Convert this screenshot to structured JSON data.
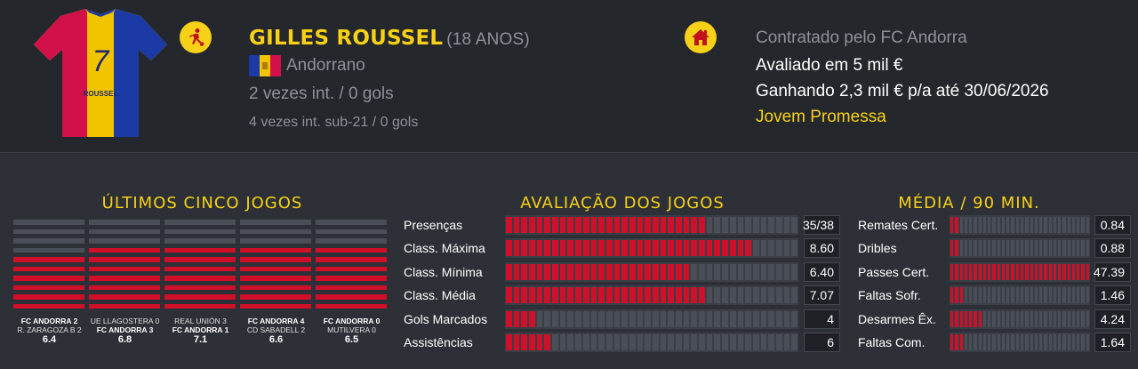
{
  "player": {
    "shirt_name": "ROUSSEL",
    "shirt_number": "7",
    "name": "GILLES ROUSSEL",
    "age": "(18 ANOS)",
    "nationality": "Andorrano",
    "caps": "2 vezes int. / 0 gols",
    "caps_u21": "4 vezes int. sub-21 / 0 gols"
  },
  "icons": {
    "position": "football-player-icon",
    "home": "home-icon"
  },
  "contract": {
    "line1": "Contratado pelo FC Andorra",
    "line2": "Avaliado em 5 mil €",
    "line3": "Ganhando 2,3 mil € p/a até 30/06/2026",
    "line4": "Jovem Promessa"
  },
  "colors": {
    "accent": "#f7d117",
    "bar_red": "#d0102a",
    "bar_grey": "#4a4e56"
  },
  "last_five": {
    "title": "ÚLTIMOS CINCO JOGOS",
    "games": [
      {
        "home": "FC ANDORRA 2",
        "away": "R. ZARAGOZA B 2",
        "home_bold": true,
        "rating": "6.4",
        "rating_value": 6.4
      },
      {
        "home": "UE LLAGOSTERA 0",
        "away": "FC ANDORRA 3",
        "home_bold": false,
        "rating": "6.8",
        "rating_value": 6.8
      },
      {
        "home": "REAL UNIÓN 3",
        "away": "FC ANDORRA 1",
        "home_bold": false,
        "rating": "7.1",
        "rating_value": 7.1
      },
      {
        "home": "FC ANDORRA 4",
        "away": "CD SABADELL 2",
        "home_bold": true,
        "rating": "6.6",
        "rating_value": 6.6
      },
      {
        "home": "FC ANDORRA 0",
        "away": "MUTILVERA 0",
        "home_bold": true,
        "rating": "6.5",
        "rating_value": 6.5
      }
    ]
  },
  "ratings": {
    "title": "AVALIAÇÃO DOS JOGOS",
    "rows": [
      {
        "label": "Presenças",
        "value": "35/38",
        "fraction": 0.66
      },
      {
        "label": "Class. Máxima",
        "value": "8.60",
        "fraction": 0.83
      },
      {
        "label": "Class. Mínima",
        "value": "6.40",
        "fraction": 0.61
      },
      {
        "label": "Class. Média",
        "value": "7.07",
        "fraction": 0.68
      },
      {
        "label": "Gols Marcados",
        "value": "4",
        "fraction": 0.1
      },
      {
        "label": "Assistências",
        "value": "6",
        "fraction": 0.15
      }
    ]
  },
  "per90": {
    "title": "MÉDIA / 90 MIN.",
    "rows": [
      {
        "label": "Remates Cert.",
        "value": "0.84",
        "fraction": 0.04
      },
      {
        "label": "Dribles",
        "value": "0.88",
        "fraction": 0.04
      },
      {
        "label": "Passes Cert.",
        "value": "47.39",
        "fraction": 0.98
      },
      {
        "label": "Faltas Sofr.",
        "value": "1.46",
        "fraction": 0.09
      },
      {
        "label": "Desarmes Êx.",
        "value": "4.24",
        "fraction": 0.22
      },
      {
        "label": "Faltas Com.",
        "value": "1.64",
        "fraction": 0.09
      }
    ]
  }
}
